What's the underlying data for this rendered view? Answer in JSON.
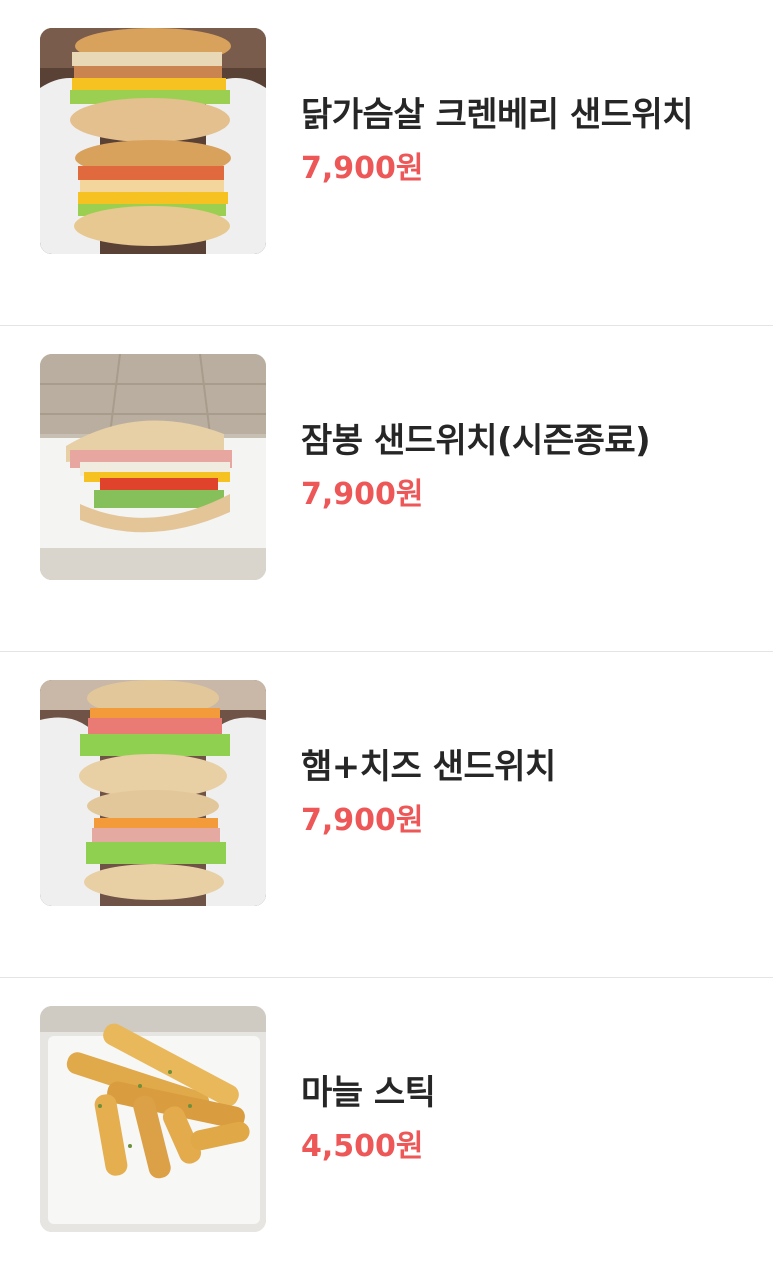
{
  "menu": {
    "items": [
      {
        "name": "닭가슴살 크렌베리 샌드위치",
        "price": "7,900원",
        "image": "chicken-cranberry-sandwich-photo"
      },
      {
        "name": "잠봉 샌드위치(시즌종료)",
        "price": "7,900원",
        "image": "jambon-sandwich-photo"
      },
      {
        "name": "햄+치즈 샌드위치",
        "price": "7,900원",
        "image": "ham-cheese-sandwich-photo"
      },
      {
        "name": "마늘 스틱",
        "price": "4,500원",
        "image": "garlic-stick-photo"
      }
    ]
  },
  "colors": {
    "price": "#ee5757",
    "name": "#262626",
    "divider": "#e4e4e4"
  }
}
